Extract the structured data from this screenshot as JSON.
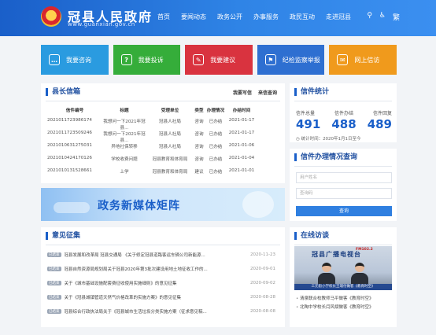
{
  "header": {
    "title": "冠县人民政府",
    "url": "www.guanxian.gov.cn",
    "nav": [
      "首页",
      "要闻动态",
      "政务公开",
      "办事服务",
      "政民互动",
      "走进冠县"
    ],
    "icons": {
      "search": "⚲",
      "accessibility": "♿",
      "lang": "繁"
    }
  },
  "tiles": [
    {
      "label": "我要咨询",
      "color": "#2a9be0",
      "icon": "…"
    },
    {
      "label": "我要投诉",
      "color": "#35ad3a",
      "icon": "?"
    },
    {
      "label": "我要建议",
      "color": "#d9333f",
      "icon": "✎"
    },
    {
      "label": "纪检监察举报",
      "color": "#2e6fd1",
      "icon": "⚑"
    },
    {
      "label": "网上信访",
      "color": "#f09a1c",
      "icon": "✉"
    }
  ],
  "mailbox": {
    "title": "县长信箱",
    "tabs": [
      "我要写信",
      "来信查询"
    ],
    "headers": [
      "信件编号",
      "标题",
      "受理单位",
      "类型",
      "办理情况",
      "办结时间"
    ],
    "rows": [
      [
        "2021011723986174",
        "我想问一下2021年冠县...",
        "冠县人社局",
        "咨询",
        "已办结",
        "2021-01-17"
      ],
      [
        "2021011723509246",
        "我想问一下2021年冠县...",
        "冠县人社局",
        "咨询",
        "已办结",
        "2021-01-17"
      ],
      [
        "2021010631275031",
        "异地社保转移",
        "冠县人社局",
        "咨询",
        "已办结",
        "2021-01-06"
      ],
      [
        "2021010424170126",
        "学校收费问题",
        "冠县教育和体育局",
        "咨询",
        "已办结",
        "2021-01-04"
      ],
      [
        "202101013152866​1",
        "上学",
        "冠县教育和体育局",
        "建议",
        "已办结",
        "2021-01-01"
      ]
    ]
  },
  "stats": {
    "title": "信件统计",
    "labels": [
      "信件总量",
      "信件办结",
      "信件回复"
    ],
    "values": [
      "491",
      "488",
      "489"
    ],
    "date": "统计时间：2020年1月1日至今"
  },
  "query": {
    "title": "信件办理情况查询",
    "user_placeholder": "用户姓名",
    "code_placeholder": "查询码",
    "button": "查询"
  },
  "banner": {
    "text": "政务新媒体矩阵"
  },
  "opinions": {
    "title": "意见征集",
    "items": [
      {
        "tag": "已结束",
        "text": "冠县发展和改革局 冠县交通局 《关于修定冠县道路客运车辆公司新能源...",
        "date": "2020-11-23"
      },
      {
        "tag": "已结束",
        "text": "冠县自然资源局规划局关于冠县2020年第3批次建设用地土地征收工作的...",
        "date": "2020-09-01"
      },
      {
        "tag": "已结束",
        "text": "关于《城市基础设施配套费征收使用实施细则》的意见征集",
        "date": "2020-09-02"
      },
      {
        "tag": "已结束",
        "text": "关于《冠县城镇管道天然气价格改革的实施方案》的意见征集",
        "date": "2020-08-28"
      },
      {
        "tag": "已结束",
        "text": "冠县综合行政执法局关于《冠县城市生活垃圾分类实施方案（征求意见稿...",
        "date": "2020-08-08"
      }
    ]
  },
  "interview": {
    "title": "在线访谈",
    "video_logo": "冠县广播电视台",
    "video_fm": "FM102.2",
    "video_caption": "三元街小学校长王瑞付做客《教育时空》",
    "links": [
      "清泉联合校教师马平做客《教育时空》",
      "北陶中学校长闫风斌做客《教育时空》"
    ]
  }
}
